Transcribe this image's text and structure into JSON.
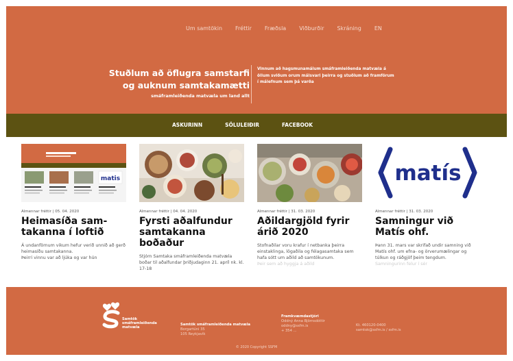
{
  "nav": {
    "items": [
      "Um samtökin",
      "Fréttir",
      "Fræðsla",
      "Viðburðir",
      "Skráning",
      "EN"
    ]
  },
  "hero": {
    "slogan_line1": "Stuðlum að öflugra samstarfi",
    "slogan_line2": "og auknum samtakamætti",
    "slogan_line3": "smáframleiðenda matvæla um land allt",
    "tagline": "Vinnum að hagsmunamálum smáframleiðenda matvæla á öllum sviðum orum málsvari þeirra og stuðlum að framförum í málefnum sem þá varða"
  },
  "subnav": {
    "items": [
      "ASKURINN",
      "SÖLULEIÐIR",
      "FACEBOOK"
    ]
  },
  "cards": [
    {
      "meta": "Almennar fréttir | 05. 04. 2020",
      "title": "Heimasíða sam-takanna í loftið",
      "excerpt": "Á undanförnum vikum hefur verið unnið að gerð heimasíðu samtakanna.",
      "excerpt_fade": "Þeirri vinnu var að ljúka og var hún"
    },
    {
      "meta": "Almennar fréttir | 04. 04. 2020",
      "title": "Fyrsti aðalfundur samtakanna boðaður",
      "excerpt": "Stjórn Samtaka smáframleiðenda matvæla boðar til aðalfundar þriðjudaginn 21. apríl nk. kl. 17-18",
      "excerpt_fade": ""
    },
    {
      "meta": "Almennar fréttir | 31. 03. 2020",
      "title": "Aðildargjöld fyrir árið 2020",
      "excerpt": "Stofnaðilar voru krafur í netbanka þeirra einstaklinga, lögaðila og félagasamtaka sem hafa sótt um aðild að samtökunum.",
      "excerpt_fade": "Þeir sem að hyggja á aðild"
    },
    {
      "meta": "Almennar fréttir | 31. 03. 2020",
      "title": "Samningur við Matís ohf.",
      "excerpt": "Þann 31. mars var skrifað undir samning við Matís ohf. um efna- og örverumælingar og túlkun og ráðgjöf þeim tengdum.",
      "excerpt_fade": "Samningurinn felur í sér"
    }
  ],
  "matis_logo": "matís",
  "footer": {
    "logo_text": [
      "Samtök",
      "smáframleiðenda",
      "matvæla"
    ],
    "org_name": "Samtök smáframleiðenda matvæla",
    "address": [
      "Borgartúni 35",
      "105 Reykjavík"
    ],
    "board_title": "Framkvæmdastjóri",
    "board_lines": [
      "Oddný Anna Björnsdóttir",
      "oddny@ssfm.is",
      "+ 354 ..."
    ],
    "contact": [
      "Kt. 460120-0400",
      "samtok@ssfm.is / ssfm.is"
    ],
    "copyright": "© 2020 Copyright SSFM"
  },
  "colors": {
    "hero": "#d26a43",
    "subnav": "#5c5212",
    "footer": "#d26a43",
    "matis": "#1f2f8c"
  }
}
